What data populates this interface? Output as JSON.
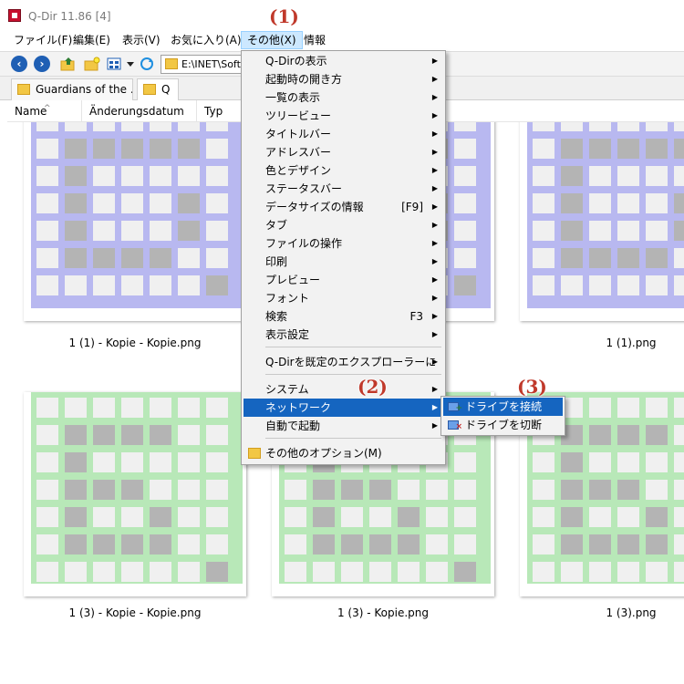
{
  "window": {
    "title": "Q-Dir 11.86 [4]"
  },
  "menubar": {
    "items": [
      {
        "label": "ファイル(F)"
      },
      {
        "label": "編集(E)"
      },
      {
        "label": "表示(V)"
      },
      {
        "label": "お気に入り(A)"
      },
      {
        "label": "その他(X)",
        "active": true
      },
      {
        "label": "情報"
      }
    ]
  },
  "toolbar": {
    "back_icon": "back-arrow-icon",
    "forward_icon": "forward-arrow-icon",
    "address": "E:\\INET\\Soft"
  },
  "tabs": [
    {
      "label": "Guardians of the ..."
    },
    {
      "label": "Q",
      "active": true
    }
  ],
  "columns": [
    "Name",
    "Änderungsdatum",
    "Typ"
  ],
  "thumbnails": [
    {
      "caption": "1 (1) - Kopie - Kopie.png",
      "color": "#b8b8f0"
    },
    {
      "caption": "",
      "color": "#b8b8f0"
    },
    {
      "caption": "1 (1).png",
      "color": "#b8b8f0"
    },
    {
      "caption": "1 (3) - Kopie - Kopie.png",
      "color": "#b8e8b8"
    },
    {
      "caption": "1 (3) - Kopie.png",
      "color": "#b8e8b8"
    },
    {
      "caption": "1 (3).png",
      "color": "#b8e8b8"
    }
  ],
  "dropdown": {
    "items": [
      {
        "label": "Q-Dirの表示",
        "submenu": true
      },
      {
        "label": "起動時の開き方",
        "submenu": true
      },
      {
        "label": "一覧の表示",
        "submenu": true
      },
      {
        "label": "ツリービュー",
        "submenu": true
      },
      {
        "label": "タイトルバー",
        "submenu": true
      },
      {
        "label": "アドレスバー",
        "submenu": true
      },
      {
        "label": "色とデザイン",
        "submenu": true
      },
      {
        "label": "ステータスバー",
        "submenu": true
      },
      {
        "label": "データサイズの情報",
        "shortcut": "[F9]",
        "submenu": true
      },
      {
        "label": "タブ",
        "submenu": true
      },
      {
        "label": "ファイルの操作",
        "submenu": true
      },
      {
        "label": "印刷",
        "submenu": true
      },
      {
        "label": "プレビュー",
        "submenu": true
      },
      {
        "label": "フォント",
        "submenu": true
      },
      {
        "label": "検索",
        "shortcut": "F3",
        "submenu": true
      },
      {
        "label": "表示設定",
        "submenu": true
      },
      {
        "label": "Q-Dirを既定のエクスプローラーに",
        "submenu": true
      },
      {
        "label": "システム",
        "submenu": true
      },
      {
        "label": "ネットワーク",
        "submenu": true,
        "selected": true
      },
      {
        "label": "自動で起動",
        "submenu": true
      },
      {
        "label": "その他のオプション(M)"
      }
    ]
  },
  "submenu": {
    "items": [
      {
        "label": "ドライブを接続",
        "selected": true,
        "icon": "network-drive-connect-icon"
      },
      {
        "label": "ドライブを切断",
        "icon": "network-drive-disconnect-icon"
      }
    ]
  },
  "callouts": [
    "(1)",
    "(2)",
    "(3)"
  ],
  "colors": {
    "menu_highlight": "#1565c0",
    "callout": "#c0392b",
    "app_icon": "#c8102e"
  }
}
